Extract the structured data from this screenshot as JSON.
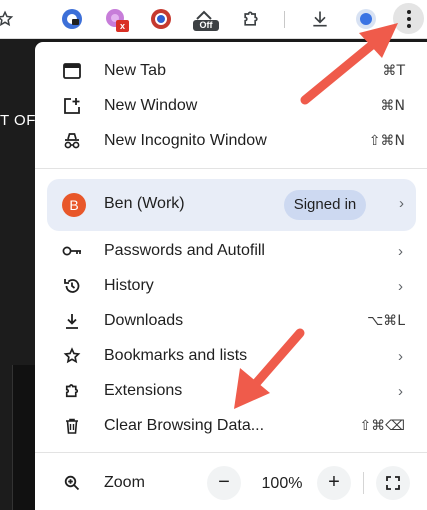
{
  "toolbar": {
    "icons": [
      "star-icon",
      "extension-lock-icon",
      "extension-blocked-icon",
      "extension-globe-icon",
      "extension-off-icon",
      "extensions-puzzle-icon",
      "download-icon",
      "profile-icon",
      "menu-kebab-icon"
    ],
    "blocked_badge": "x",
    "off_badge": "Off"
  },
  "background": {
    "page_text": "T OF"
  },
  "menu": {
    "new_tab": {
      "label": "New Tab",
      "shortcut": "⌘T",
      "icon": "new-tab-icon"
    },
    "new_window": {
      "label": "New Window",
      "shortcut": "⌘N",
      "icon": "new-window-icon"
    },
    "incognito": {
      "label": "New Incognito Window",
      "shortcut": "⇧⌘N",
      "icon": "incognito-icon"
    },
    "profile": {
      "initial": "B",
      "name": "Ben (Work)",
      "status": "Signed in",
      "avatar_color": "#e8572a"
    },
    "passwords": {
      "label": "Passwords and Autofill",
      "icon": "key-icon"
    },
    "history": {
      "label": "History",
      "icon": "history-icon"
    },
    "downloads": {
      "label": "Downloads",
      "shortcut": "⌥⌘L",
      "icon": "download-icon"
    },
    "bookmarks": {
      "label": "Bookmarks and lists",
      "icon": "star-icon"
    },
    "extensions": {
      "label": "Extensions",
      "icon": "puzzle-icon"
    },
    "clear_data": {
      "label": "Clear Browsing Data...",
      "shortcut": "⇧⌘⌫",
      "icon": "trash-icon"
    },
    "zoom": {
      "label": "Zoom",
      "value": "100%",
      "minus": "−",
      "plus": "+",
      "icon": "zoom-icon"
    },
    "chevron": "›"
  },
  "colors": {
    "arrow": "#ef5b4b",
    "profile_bg": "#e8edf7",
    "signed_in_bg": "#cdd9f1"
  }
}
